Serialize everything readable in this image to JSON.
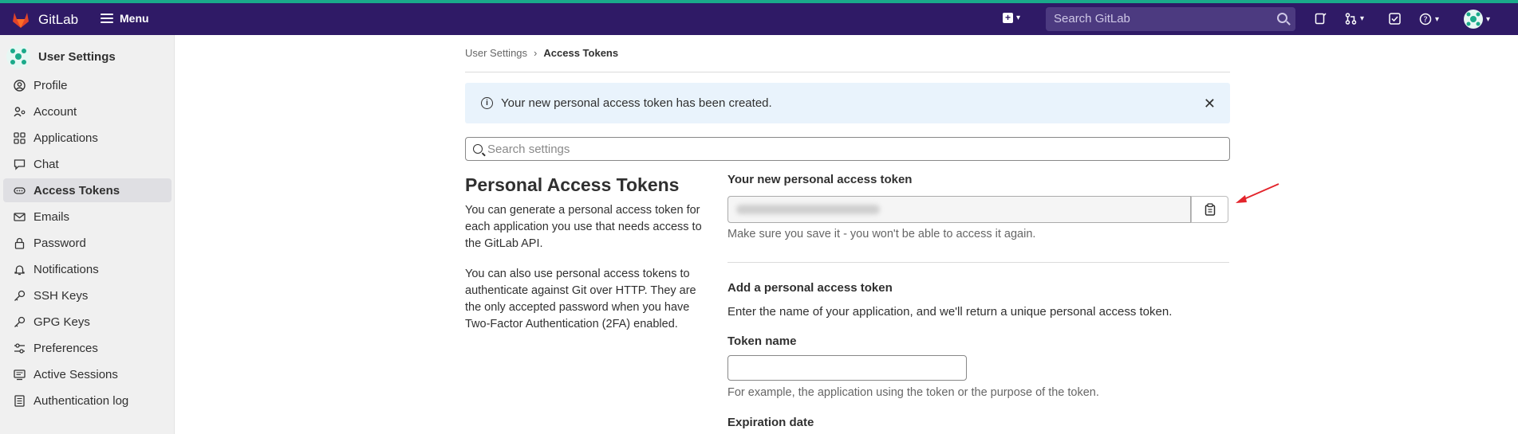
{
  "topbar": {
    "brand": "GitLab",
    "menu_label": "Menu",
    "search_placeholder": "Search GitLab",
    "icons": [
      "plus-square-icon",
      "issues-icon",
      "merge-request-icon",
      "todo-icon",
      "help-icon",
      "avatar"
    ],
    "colors": {
      "bg": "#2f1a66",
      "accent": "#1aaa8a"
    }
  },
  "sidebar": {
    "title": "User Settings",
    "items": [
      {
        "label": "Profile",
        "icon": "profile-icon"
      },
      {
        "label": "Account",
        "icon": "account-icon"
      },
      {
        "label": "Applications",
        "icon": "applications-icon"
      },
      {
        "label": "Chat",
        "icon": "chat-icon"
      },
      {
        "label": "Access Tokens",
        "icon": "token-icon",
        "active": true
      },
      {
        "label": "Emails",
        "icon": "email-icon"
      },
      {
        "label": "Password",
        "icon": "lock-icon"
      },
      {
        "label": "Notifications",
        "icon": "bell-icon"
      },
      {
        "label": "SSH Keys",
        "icon": "key-icon"
      },
      {
        "label": "GPG Keys",
        "icon": "key-icon"
      },
      {
        "label": "Preferences",
        "icon": "preferences-icon"
      },
      {
        "label": "Active Sessions",
        "icon": "monitor-icon"
      },
      {
        "label": "Authentication log",
        "icon": "log-icon"
      }
    ]
  },
  "breadcrumb": {
    "parent": "User Settings",
    "current": "Access Tokens"
  },
  "alert": {
    "text": "Your new personal access token has been created."
  },
  "settings_search": {
    "placeholder": "Search settings"
  },
  "section": {
    "title": "Personal Access Tokens",
    "para1": "You can generate a personal access token for each application you use that needs access to the GitLab API.",
    "para2": "You can also use personal access tokens to authenticate against Git over HTTP. They are the only accepted password when you have Two-Factor Authentication (2FA) enabled."
  },
  "new_token": {
    "label": "Your new personal access token",
    "help": "Make sure you save it - you won't be able to access it again."
  },
  "add_token": {
    "heading": "Add a personal access token",
    "intro": "Enter the name of your application, and we'll return a unique personal access token.",
    "name_label": "Token name",
    "name_help": "For example, the application using the token or the purpose of the token.",
    "expiration_label": "Expiration date"
  }
}
